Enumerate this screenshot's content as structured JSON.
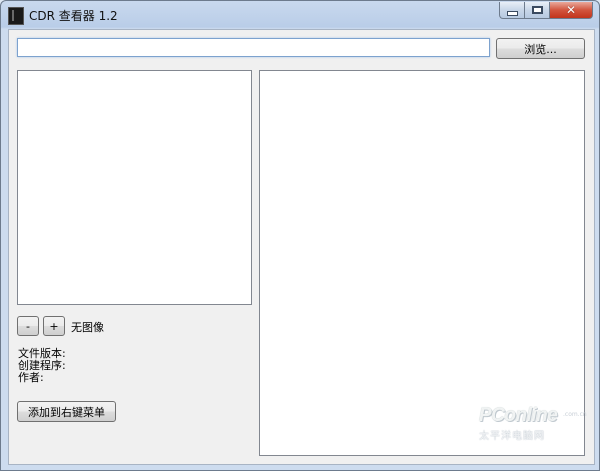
{
  "window": {
    "title": "CDR 查看器 1.2",
    "icon": "app-icon",
    "controls": {
      "minimize": "_",
      "maximize": "□",
      "close": "✕"
    }
  },
  "toolbar": {
    "path_value": "",
    "browse_label": "浏览..."
  },
  "zoom": {
    "out_label": "-",
    "in_label": "+",
    "status": "无图像"
  },
  "info": {
    "version_label": "文件版本:",
    "creator_label": "创建程序:",
    "author_label": "作者:"
  },
  "actions": {
    "context_menu_label": "添加到右键菜单"
  },
  "watermark": {
    "brand": "PConline",
    "domain": ".com.cn",
    "tagline": "太平洋电脑网"
  },
  "colors": {
    "frame": "#b9cde8",
    "client_bg": "#f0f0f0",
    "close_button": "#c2341c"
  }
}
